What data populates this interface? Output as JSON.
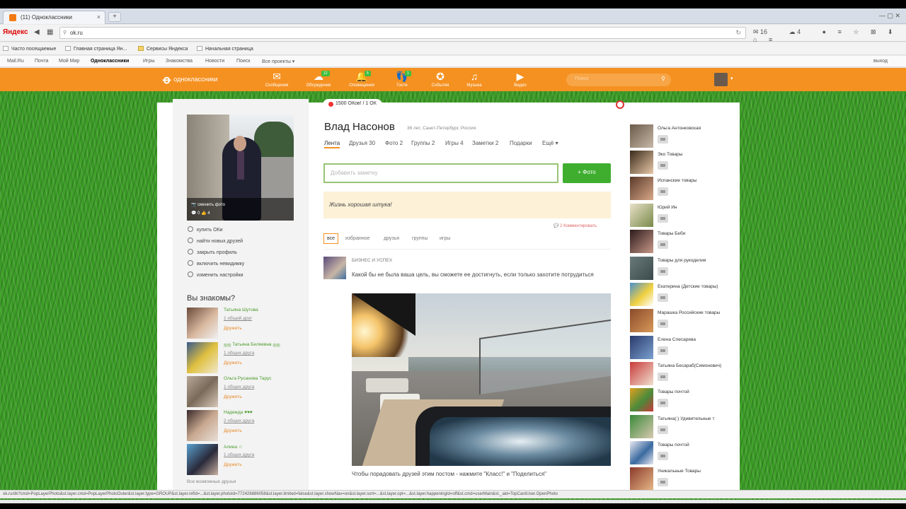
{
  "browser": {
    "tab_title": "(11) Одноклассники",
    "tab_close": "×",
    "newtab": "+",
    "window_controls": "—  ▢  ✕",
    "yandex_logo": "Яндекс",
    "url": "ok.ru",
    "toolbar_counts": {
      "mail": "16",
      "weather": "4"
    },
    "bookmarks": [
      "Часто посещаемые",
      "Главная страница Ян...",
      "Сервисы Яндекса",
      "Начальная страница"
    ]
  },
  "mailbar": {
    "items": [
      "Mail.Ru",
      "Почта",
      "Мой Мир",
      "Одноклассники",
      "Игры",
      "Знакомства",
      "Новости",
      "Поиск",
      "Все проекты ▾"
    ],
    "logout": "выход"
  },
  "ok_header": {
    "logo_text": "одноклассники",
    "nav": [
      {
        "label": "Сообщения",
        "icon": "envelope-icon",
        "glyph": "✉",
        "badge": ""
      },
      {
        "label": "Обсуждения",
        "icon": "discussions-icon",
        "glyph": "☁",
        "badge": "12"
      },
      {
        "label": "Оповещения",
        "icon": "bell-icon",
        "glyph": "🔔",
        "badge": "5"
      },
      {
        "label": "Гости",
        "icon": "guests-icon",
        "glyph": "👣",
        "badge": "1"
      },
      {
        "label": "События",
        "icon": "events-icon",
        "glyph": "✪",
        "badge": ""
      },
      {
        "label": "Музыка",
        "icon": "music-icon",
        "glyph": "♫",
        "badge": ""
      },
      {
        "label": "Видео",
        "icon": "video-icon",
        "glyph": "▶",
        "badge": ""
      }
    ],
    "search_placeholder": "Поиск",
    "caret": "▾"
  },
  "promo": {
    "text": "1500 ОКов! / 1 ОК"
  },
  "profile": {
    "change_photo": "сменить фото",
    "photo_stats": "💬 0   👍 4",
    "menu": [
      "купить ОКи",
      "найти новых друзей",
      "закрыть профиль",
      "включить невидимку",
      "изменить настройки"
    ],
    "znakomy_title": "Вы знакомы?",
    "friends": [
      {
        "name": "Татьяна Шутова",
        "mutual": "1 общий друг",
        "add": "Дружить"
      },
      {
        "name": "ஐஐ Татьяна Беляевна ஐஐ",
        "mutual": "1 общих друга",
        "add": "Дружить"
      },
      {
        "name": "Ольга Русанова Тарус",
        "mutual": "1 общих друга",
        "add": "Дружить"
      },
      {
        "name": "Надежда ♥♥♥",
        "mutual": "2 общих друга",
        "add": "Дружить"
      },
      {
        "name": "Алина ☆",
        "mutual": "1 общих друга",
        "add": "Дружить"
      }
    ],
    "all_friends": "Все возможные друзья"
  },
  "user": {
    "name": "Влад Насонов",
    "meta": "36 лет, Санкт-Петербург, Россия",
    "tabs": [
      "Лента",
      "Друзья 30",
      "Фото 2",
      "Группы 2",
      "Игры 4",
      "Заметки 2",
      "Подарки",
      "Ещё ▾"
    ]
  },
  "composer": {
    "placeholder": "Добавить заметку",
    "photo_button": "+ Фото",
    "status": "Жизнь хорошая штука!",
    "comments": "💬 2 Комментировать"
  },
  "feed": {
    "filters": [
      "все",
      "избранное",
      "друзья",
      "группы",
      "игры"
    ],
    "post": {
      "group": "БИЗНЕС И УСПЕХ",
      "text": "Какой бы не была ваша цель, вы сможете ее достигнуть, если только захотите потрудиться",
      "caption": "Чтобы порадовать друзей этим постом - нажмите \"Класс!\" и \"Поделиться\""
    }
  },
  "groups": [
    "Ольга Антонковская",
    "Эко Товары",
    "Испанские товары",
    "Юрий Ин",
    "Товары Беби",
    "Товары для рукоделия",
    "Екатерина (Детские товары)",
    "Марашка Российские товары",
    "Елена Слесарева",
    "Татьяна Бесараб(Симонович)",
    "Товары почтой",
    "Татьяна(:) Удивительные т",
    "Товары почтой",
    "Уникальные Товары"
  ],
  "statusbar": "ok.ru/dk?cmd=PopLayerPhoto&st.layer.cmd=PopLayerPhotoOuter&st.layer.type=GROUP&st.layer.refId=...&st.layer.photoId=772426886058&st.layer.limited=false&st.layer.showNav=on&st.layer.sort=...&st.layer.opt=...&st.layer.happeningId=off&st.cmd=userMain&st._aid=TopCardUser.OpenPhoto"
}
